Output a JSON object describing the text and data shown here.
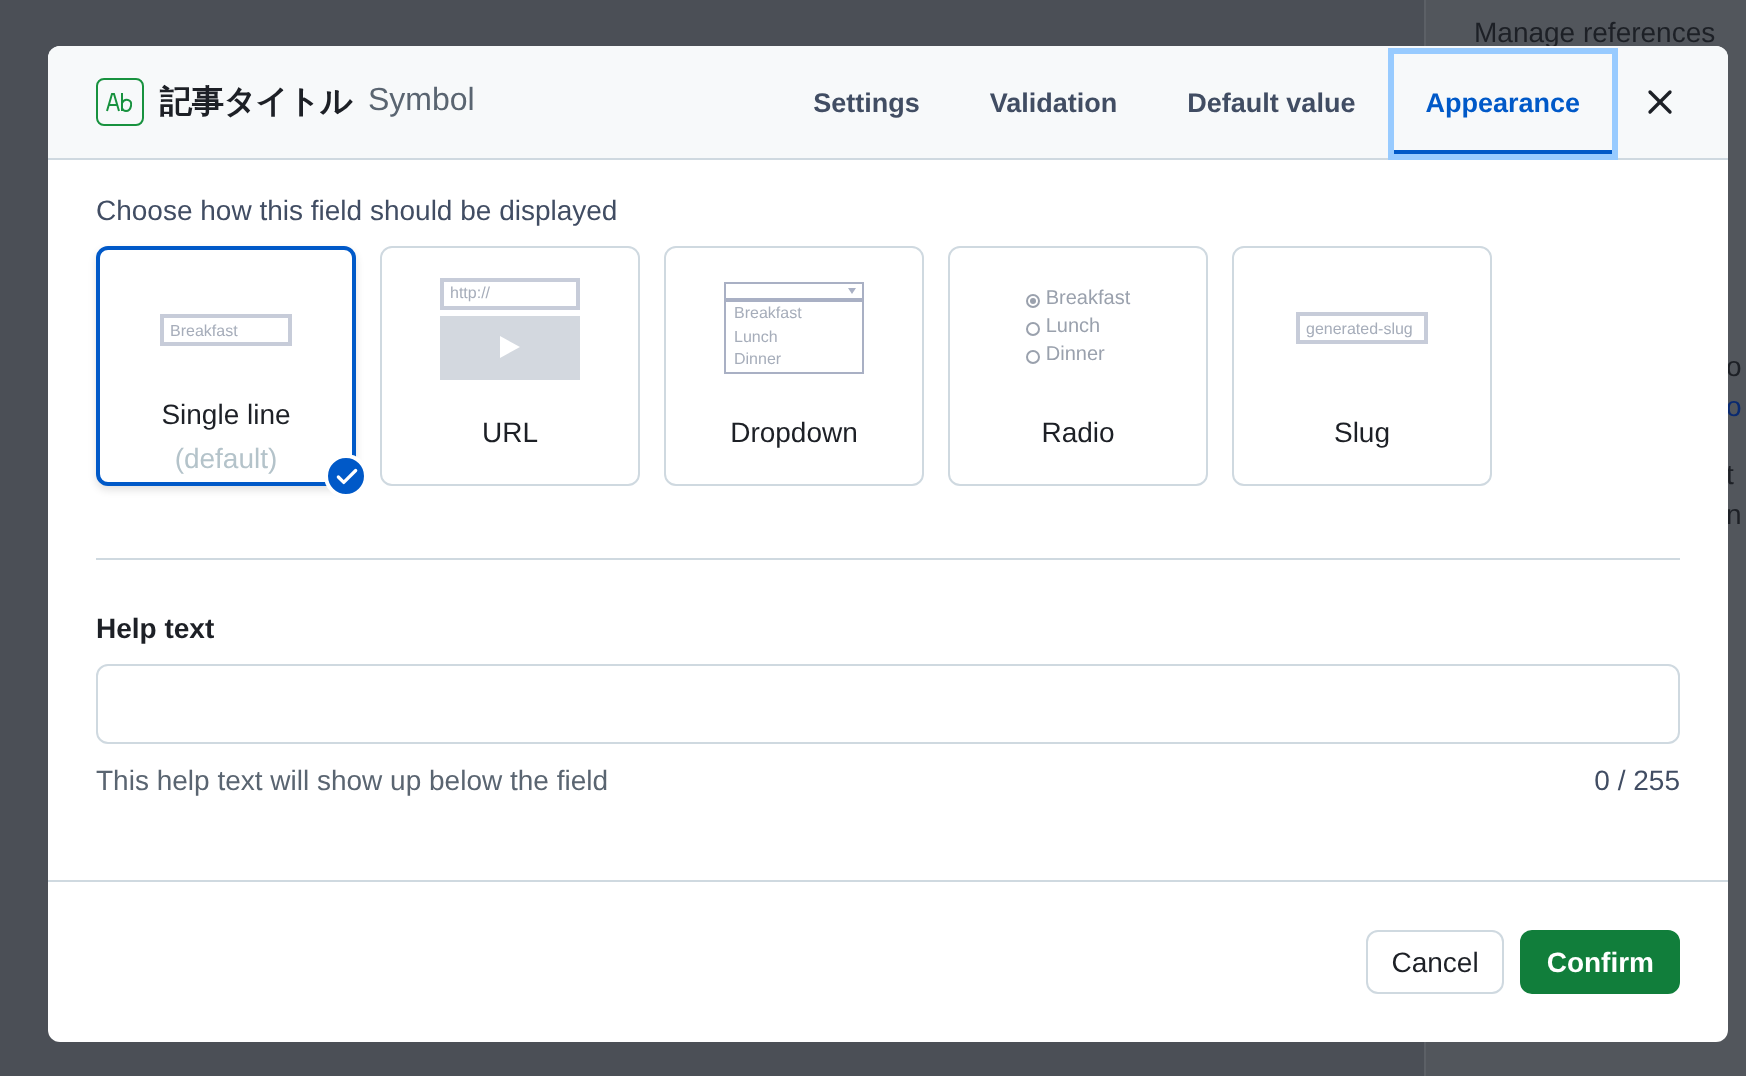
{
  "background": {
    "panel_title": "Manage references",
    "fragments": [
      {
        "kind": "text",
        "text": "o"
      },
      {
        "kind": "link",
        "text": "o"
      },
      {
        "kind": "text",
        "text": "t"
      },
      {
        "kind": "text",
        "text": "n"
      }
    ]
  },
  "modal": {
    "field_name": "記事タイトル",
    "field_type": "Symbol",
    "tabs": [
      {
        "label": "Settings",
        "selected": false
      },
      {
        "label": "Validation",
        "selected": false
      },
      {
        "label": "Default value",
        "selected": false
      },
      {
        "label": "Appearance",
        "selected": true
      }
    ],
    "prompt": "Choose how this field should be displayed",
    "options": [
      {
        "kind": "single_line",
        "label": "Single line",
        "note": "(default)",
        "selected": true,
        "preview": [
          {
            "text": "Breakfast"
          }
        ]
      },
      {
        "kind": "url",
        "label": "URL",
        "selected": false,
        "preview": [
          {
            "text": "http://"
          }
        ]
      },
      {
        "kind": "dropdown",
        "label": "Dropdown",
        "selected": false,
        "preview": [
          {
            "text": "Breakfast"
          },
          {
            "text": "Lunch"
          },
          {
            "text": "Dinner"
          }
        ]
      },
      {
        "kind": "radio",
        "label": "Radio",
        "selected": false,
        "preview": [
          {
            "text": "Breakfast",
            "checked": true
          },
          {
            "text": "Lunch",
            "checked": false
          },
          {
            "text": "Dinner",
            "checked": false
          }
        ]
      },
      {
        "kind": "slug",
        "label": "Slug",
        "selected": false,
        "preview": [
          {
            "text": "generated-slug"
          }
        ]
      }
    ],
    "help_text": {
      "label": "Help text",
      "hint": "This help text will show up below the field",
      "counter": "0 / 255"
    },
    "buttons": [
      {
        "kind": "secondary",
        "label": "Cancel"
      },
      {
        "kind": "primary",
        "label": "Confirm"
      }
    ]
  }
}
